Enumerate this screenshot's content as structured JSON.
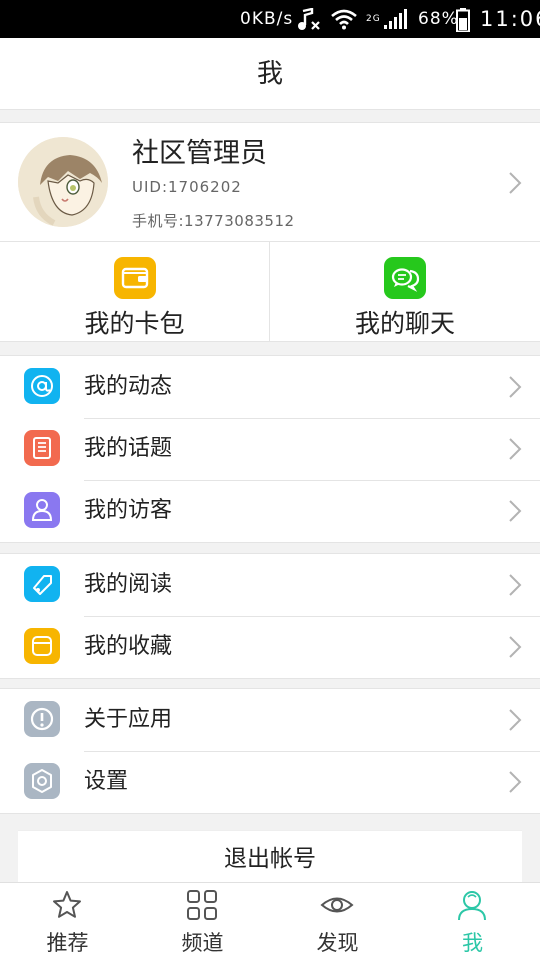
{
  "status_bar": {
    "speed": "0KB/s",
    "network_type": "2G",
    "battery": "68%",
    "time": "11:06",
    "icons": [
      "music-muted-icon",
      "wifi-icon",
      "signal-icon",
      "battery-icon"
    ]
  },
  "header": {
    "title": "我"
  },
  "profile": {
    "name": "社区管理员",
    "uid": "UID:1706202",
    "phone": "手机号:13773083512"
  },
  "quick_actions": [
    {
      "label": "我的卡包",
      "icon": "wallet-icon",
      "color": "#f7b500"
    },
    {
      "label": "我的聊天",
      "icon": "chat-icon",
      "color": "#26c81c"
    }
  ],
  "menu_groups": [
    [
      {
        "label": "我的动态",
        "icon": "at-icon",
        "color": "#11b3f0"
      },
      {
        "label": "我的话题",
        "icon": "topic-list-icon",
        "color": "#f26a4f"
      },
      {
        "label": "我的访客",
        "icon": "visitor-icon",
        "color": "#8a78f0"
      }
    ],
    [
      {
        "label": "我的阅读",
        "icon": "tag-icon",
        "color": "#11b3f0"
      },
      {
        "label": "我的收藏",
        "icon": "favorite-box-icon",
        "color": "#f7b500"
      }
    ],
    [
      {
        "label": "关于应用",
        "icon": "info-icon",
        "color": "#aab6c3"
      },
      {
        "label": "设置",
        "icon": "settings-icon",
        "color": "#aab6c3"
      }
    ]
  ],
  "logout": {
    "label": "退出帐号"
  },
  "tab_bar": {
    "active_color": "#2cc7a7",
    "tabs": [
      {
        "label": "推荐",
        "icon": "star-icon"
      },
      {
        "label": "频道",
        "icon": "grid-icon"
      },
      {
        "label": "发现",
        "icon": "eye-icon"
      },
      {
        "label": "我",
        "icon": "person-icon",
        "active": true
      }
    ]
  }
}
